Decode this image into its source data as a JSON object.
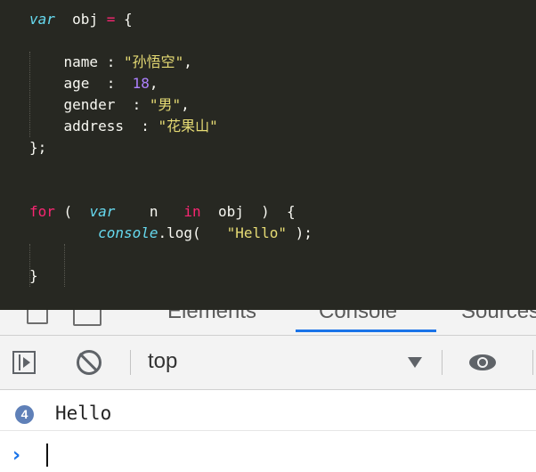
{
  "editor": {
    "lines": [
      [
        {
          "t": "var",
          "c": "kw-storage"
        },
        {
          "t": "  obj ",
          "c": "plain"
        },
        {
          "t": "=",
          "c": "kw"
        },
        {
          "t": " {",
          "c": "plain"
        }
      ],
      [],
      [
        {
          "t": "    name : ",
          "c": "plain"
        },
        {
          "t": "\"孙悟空\"",
          "c": "str"
        },
        {
          "t": ",",
          "c": "plain"
        }
      ],
      [
        {
          "t": "    age  :  ",
          "c": "plain"
        },
        {
          "t": "18",
          "c": "num"
        },
        {
          "t": ",",
          "c": "plain"
        }
      ],
      [
        {
          "t": "    gender  : ",
          "c": "plain"
        },
        {
          "t": "\"男\"",
          "c": "str"
        },
        {
          "t": ",",
          "c": "plain"
        }
      ],
      [
        {
          "t": "    address  : ",
          "c": "plain"
        },
        {
          "t": "\"花果山\"",
          "c": "str"
        }
      ],
      [
        {
          "t": "};",
          "c": "plain"
        }
      ],
      [],
      [],
      [
        {
          "t": "for",
          "c": "kw"
        },
        {
          "t": " (  ",
          "c": "plain"
        },
        {
          "t": "var",
          "c": "kw-storage"
        },
        {
          "t": "    n   ",
          "c": "plain"
        },
        {
          "t": "in",
          "c": "kw"
        },
        {
          "t": "  obj  )  {",
          "c": "plain"
        }
      ],
      [
        {
          "t": "        ",
          "c": "plain"
        },
        {
          "t": "console",
          "c": "fn"
        },
        {
          "t": ".log(   ",
          "c": "plain"
        },
        {
          "t": "\"Hello\"",
          "c": "str"
        },
        {
          "t": " );",
          "c": "plain"
        }
      ],
      [],
      [
        {
          "t": "}",
          "c": "plain"
        }
      ]
    ]
  },
  "devtools": {
    "tabs": [
      "Elements",
      "Console",
      "Sources"
    ],
    "active_tab": "Console",
    "accent_color": "#1a73e8"
  },
  "console_toolbar": {
    "context": "top",
    "icons": [
      "sidebar-toggle-icon",
      "clear-console-icon",
      "dropdown-arrow-icon",
      "eye-icon"
    ]
  },
  "console_output": {
    "messages": [
      {
        "count": "4",
        "text": "Hello"
      }
    ],
    "prompt_symbol": "›"
  }
}
